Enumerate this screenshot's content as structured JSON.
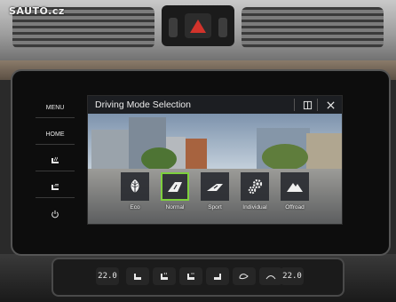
{
  "watermark": "SAUTO.cz",
  "hard_buttons": [
    {
      "label": "MENU"
    },
    {
      "label": "HOME"
    },
    {
      "label": "",
      "icon": "seat-heating-icon"
    },
    {
      "label": "",
      "icon": "seat-ventilation-icon"
    },
    {
      "label": "",
      "icon": "power-icon"
    }
  ],
  "screen": {
    "title": "Driving Mode Selection",
    "info_icon": "info-book-icon",
    "close_icon": "close-icon",
    "modes": [
      {
        "label": "Eco",
        "icon": "leaf-icon",
        "selected": false
      },
      {
        "label": "Normal",
        "icon": "road-normal-icon",
        "selected": true
      },
      {
        "label": "Sport",
        "icon": "road-sport-icon",
        "selected": false
      },
      {
        "label": "Individual",
        "icon": "gears-icon",
        "selected": false
      },
      {
        "label": "Offroad",
        "icon": "mountain-icon",
        "selected": false
      }
    ],
    "accent_color": "#7ed03d"
  },
  "climate": {
    "left_temp": "22.0",
    "right_temp": "22.0",
    "buttons": [
      "seat-heat-left-icon",
      "seat-heat-left-2-icon",
      "seat-cool-icon",
      "seat-heat-right-icon",
      "recirculation-icon",
      "windshield-icon"
    ]
  }
}
